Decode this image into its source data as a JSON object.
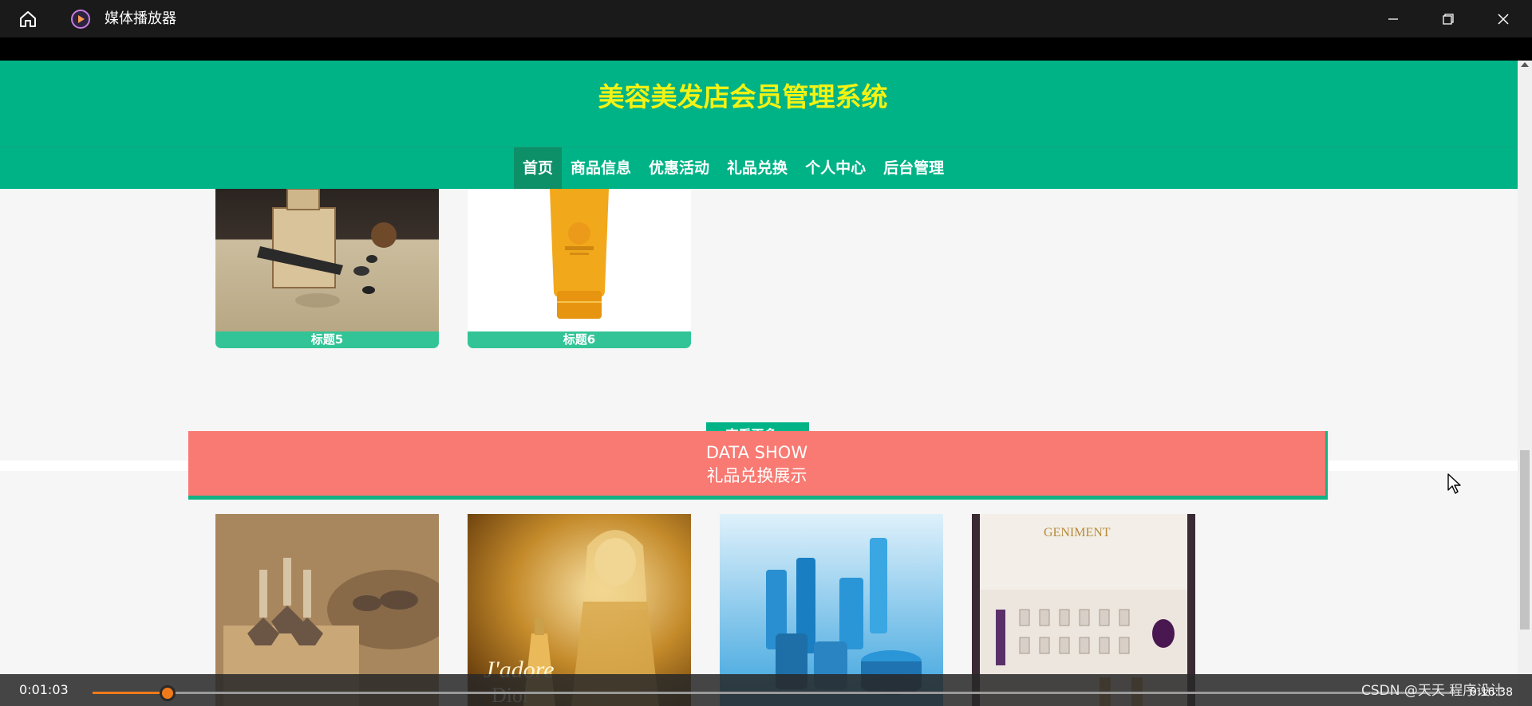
{
  "player": {
    "title": "媒体播放器",
    "current_time": "0:01:03",
    "total_time": "0:16:38",
    "progress": 0.055,
    "watermark": "CSDN @天天 程序设计",
    "accent_color": "#f07a1a"
  },
  "site": {
    "title": "美容美发店会员管理系统",
    "nav": [
      "首页",
      "商品信息",
      "优惠活动",
      "礼品兑换",
      "个人中心",
      "后台管理"
    ],
    "active_nav": "首页"
  },
  "gift_cards": [
    {
      "caption": "标题5",
      "image": "moxibustion-box"
    },
    {
      "caption": "标题6",
      "image": "sunscreen-tube"
    }
  ],
  "more_button": "查看更多",
  "section": {
    "title_en": "DATA SHOW",
    "title_cn": "礼品兑换展示"
  },
  "products": [
    {
      "image": "wooden-cupping-set"
    },
    {
      "image": "dior-jadore-perfume"
    },
    {
      "image": "blue-skincare-set"
    },
    {
      "image": "ampoule-gift-box"
    }
  ],
  "colors": {
    "header": "#00b386",
    "title": "#f2f215",
    "banner": "#f87a72",
    "caption": "#32c496"
  }
}
